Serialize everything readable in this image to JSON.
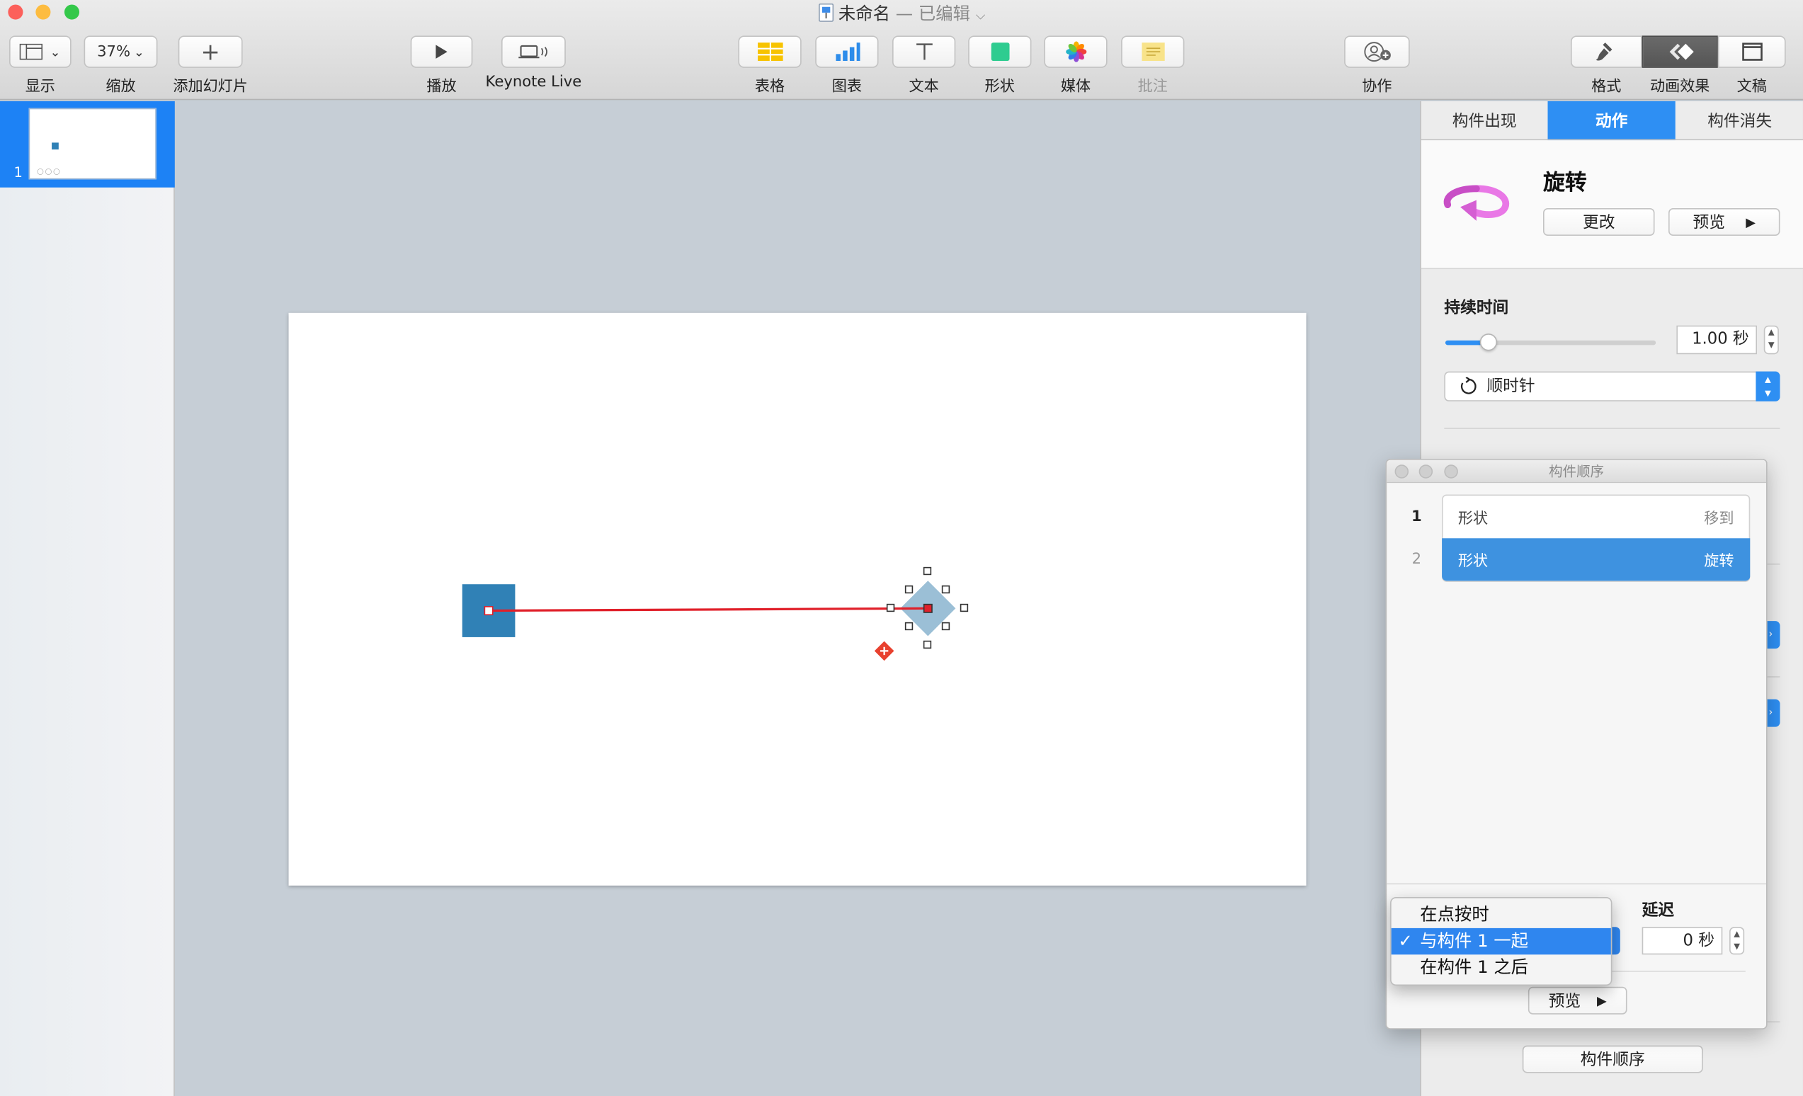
{
  "window": {
    "title": "未命名",
    "edited": "— 已编辑",
    "colors": {
      "close": "#fc605b",
      "minimize": "#fdbc40",
      "zoom": "#34c84a"
    }
  },
  "toolbar": {
    "view_label": "显示",
    "zoom_value": "37%",
    "zoom_label": "缩放",
    "add_slide_label": "添加幻灯片",
    "play_label": "播放",
    "keynote_live_label": "Keynote Live",
    "table_label": "表格",
    "chart_label": "图表",
    "text_label": "文本",
    "shape_label": "形状",
    "media_label": "媒体",
    "comment_label": "批注",
    "collaborate_label": "协作",
    "format_label": "格式",
    "animate_label": "动画效果",
    "document_label": "文稿"
  },
  "navigator": {
    "slide_number": "1",
    "accent": "#1d82f5"
  },
  "slide": {
    "shape_color": "#3081b6",
    "ghost_color": "#9bbfd6",
    "path_color": "#e0202a"
  },
  "inspector": {
    "tabs": [
      {
        "label": "构件出现"
      },
      {
        "label": "动作"
      },
      {
        "label": "构件消失"
      }
    ],
    "effect_name": "旋转",
    "change_label": "更改",
    "preview_label": "预览",
    "duration_label": "持续时间",
    "duration_value": "1.00 秒",
    "duration_fraction": 0.2,
    "direction_value": "顺时针",
    "build_order_button": "构件顺序",
    "accent": "#2e8ff3"
  },
  "build_order": {
    "title": "构件顺序",
    "rows": [
      {
        "num": "1",
        "name": "形状",
        "effect": "移到"
      },
      {
        "num": "2",
        "name": "形状",
        "effect": "旋转"
      }
    ],
    "delay_label": "延迟",
    "delay_value": "0 秒",
    "preview_label": "预览"
  },
  "start_menu": {
    "items": [
      {
        "label": "在点按时",
        "checked": false
      },
      {
        "label": "与构件 1 一起",
        "checked": true
      },
      {
        "label": "在构件 1 之后",
        "checked": false
      }
    ],
    "check": "✓"
  }
}
